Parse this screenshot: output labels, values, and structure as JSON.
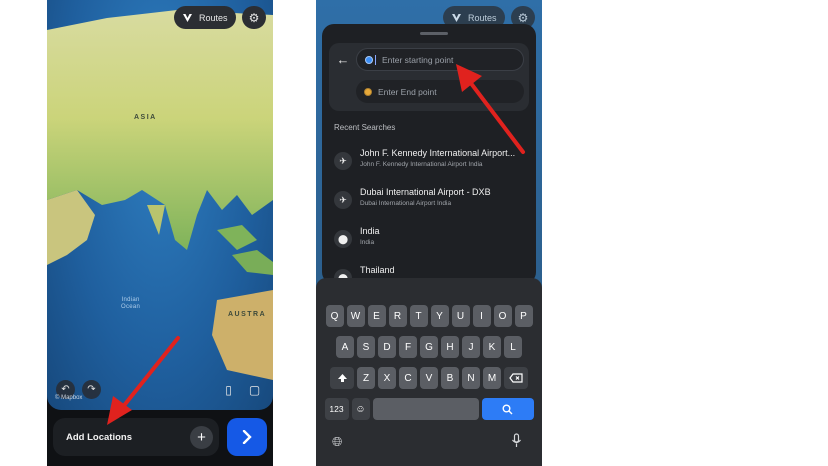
{
  "left_screen": {
    "routes_pill": {
      "label": "Routes"
    },
    "map_labels": {
      "continent_asia": "ASIA",
      "continent_australia": "AUSTRA",
      "ocean_indian": "Indian\nOcean"
    },
    "attribution": "© Mapbox",
    "bottom_bar": {
      "label": "Add Locations"
    },
    "icons": {
      "routes": "routes-logo-icon",
      "settings": "gear-icon",
      "undo": "undo-icon",
      "redo": "redo-icon",
      "book": "book-icon",
      "chat": "chat-icon",
      "add": "plus-icon",
      "go": "chevron-right-icon"
    }
  },
  "right_screen": {
    "routes_pill": {
      "label": "Routes"
    },
    "search": {
      "start_placeholder": "Enter starting point",
      "end_placeholder": "Enter End point"
    },
    "recent_title": "Recent Searches",
    "recent": [
      {
        "title": "John F. Kennedy International Airport...",
        "subtitle": "John F. Kennedy International Airport India",
        "icon": "airplane-icon"
      },
      {
        "title": "Dubai International Airport - DXB",
        "subtitle": "Dubai International Airport India",
        "icon": "airplane-icon"
      },
      {
        "title": "India",
        "subtitle": "India",
        "icon": "location-pin-icon"
      },
      {
        "title": "Thailand",
        "subtitle": "",
        "icon": "location-pin-icon"
      }
    ],
    "keyboard": {
      "row1": [
        "Q",
        "W",
        "E",
        "R",
        "T",
        "Y",
        "U",
        "I",
        "O",
        "P"
      ],
      "row2": [
        "A",
        "S",
        "D",
        "F",
        "G",
        "H",
        "J",
        "K",
        "L"
      ],
      "row3": [
        "Z",
        "X",
        "C",
        "V",
        "B",
        "N",
        "M"
      ],
      "numbers_key": "123"
    }
  },
  "colors": {
    "accent_blue": "#1559e6",
    "arrow_red": "#e0221e",
    "panel_dark": "#1e2024"
  }
}
